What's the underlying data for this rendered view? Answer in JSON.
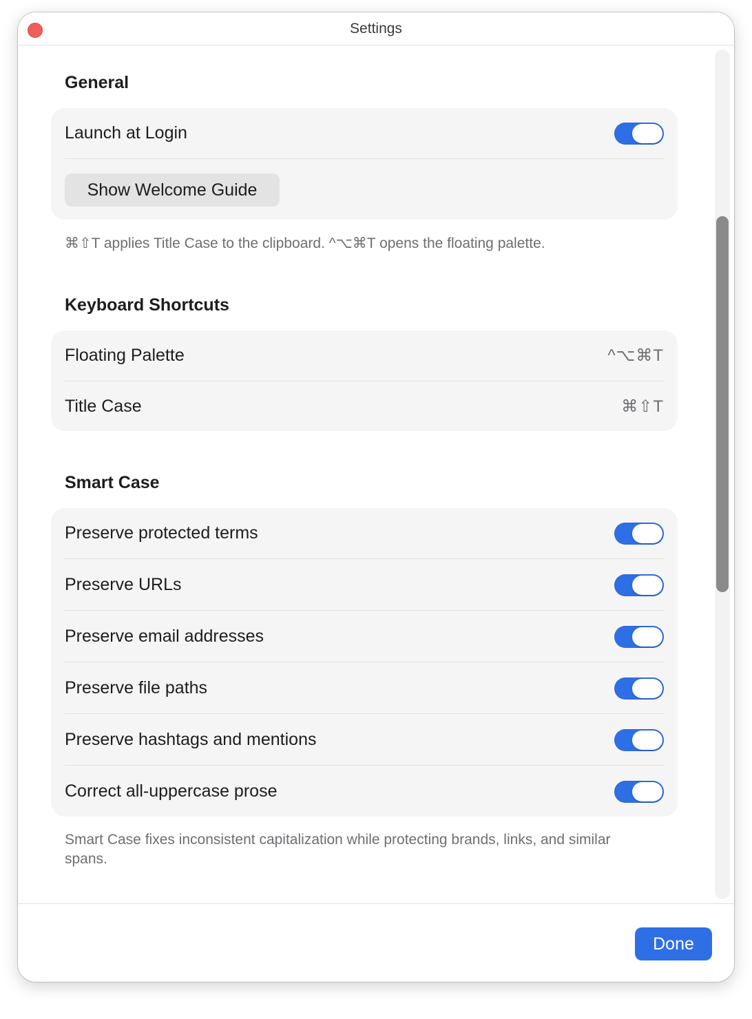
{
  "window": {
    "title": "Settings"
  },
  "general": {
    "title": "General",
    "launch_at_login": {
      "label": "Launch at Login",
      "enabled": true
    },
    "welcome_button": "Show Welcome Guide",
    "note": "⌘⇧T applies Title Case to the clipboard. ^⌥⌘T opens the floating palette."
  },
  "shortcuts": {
    "title": "Keyboard Shortcuts",
    "items": [
      {
        "label": "Floating Palette",
        "keys": "^⌥⌘T"
      },
      {
        "label": "Title Case",
        "keys": "⌘⇧T"
      }
    ]
  },
  "smart_case": {
    "title": "Smart Case",
    "items": [
      {
        "label": "Preserve protected terms",
        "enabled": true
      },
      {
        "label": "Preserve URLs",
        "enabled": true
      },
      {
        "label": "Preserve email addresses",
        "enabled": true
      },
      {
        "label": "Preserve file paths",
        "enabled": true
      },
      {
        "label": "Preserve hashtags and mentions",
        "enabled": true
      },
      {
        "label": "Correct all-uppercase prose",
        "enabled": true
      }
    ],
    "note": "Smart Case fixes inconsistent capitalization while protecting brands, links, and similar spans."
  },
  "footer": {
    "done_label": "Done"
  },
  "colors": {
    "accent": "#2f6fe5",
    "close": "#ee5f5b"
  }
}
